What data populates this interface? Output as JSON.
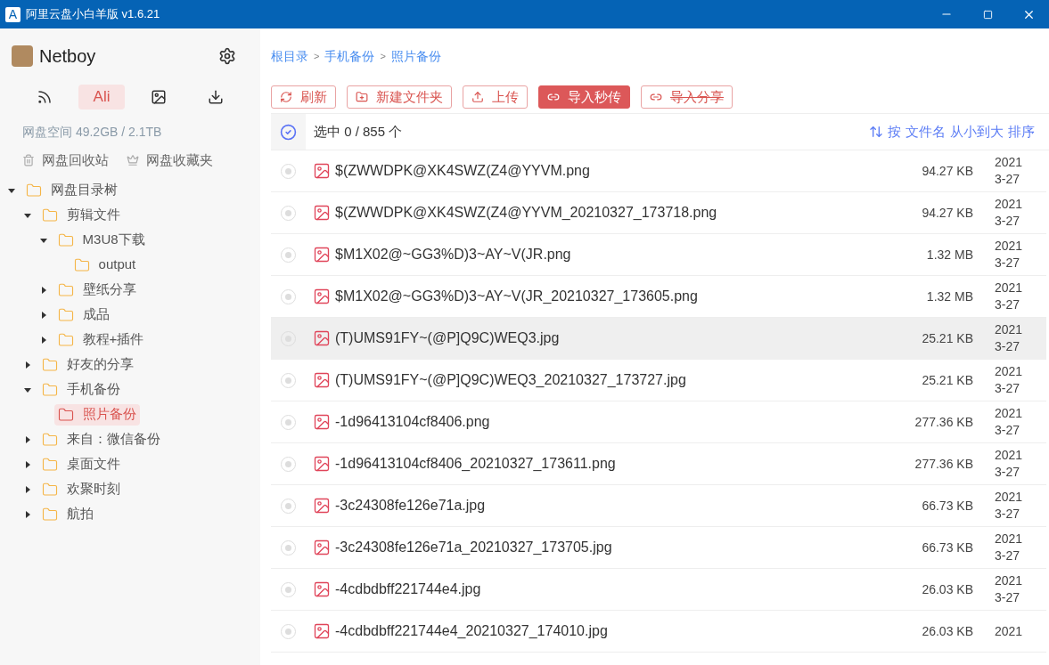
{
  "window": {
    "title": "阿里云盘小白羊版 v1.6.21",
    "logo": "A"
  },
  "user": {
    "name": "Netboy"
  },
  "tabs": [
    {
      "kind": "rss",
      "selected": false
    },
    {
      "kind": "text",
      "label": "Ali",
      "selected": true
    },
    {
      "kind": "image",
      "selected": false
    },
    {
      "kind": "download",
      "selected": false
    }
  ],
  "storage": "网盘空间 49.2GB / 2.1TB",
  "shortcuts": [
    {
      "kind": "trash",
      "label": "网盘回收站"
    },
    {
      "kind": "favorite",
      "label": "网盘收藏夹"
    }
  ],
  "tree": [
    {
      "label": "网盘目录树",
      "expanded": true,
      "selected": false,
      "children": [
        {
          "label": "剪辑文件",
          "expanded": true,
          "selected": false,
          "children": [
            {
              "label": "M3U8下载",
              "expanded": true,
              "selected": false,
              "children": [
                {
                  "label": "output",
                  "selected": false
                }
              ]
            },
            {
              "label": "壁纸分享",
              "expanded": false,
              "selected": false
            },
            {
              "label": "成品",
              "expanded": false,
              "selected": false
            },
            {
              "label": "教程+插件",
              "expanded": false,
              "selected": false
            }
          ]
        },
        {
          "label": "好友的分享",
          "expanded": false,
          "selected": false
        },
        {
          "label": "手机备份",
          "expanded": true,
          "selected": false,
          "children": [
            {
              "label": "照片备份",
              "selected": true
            }
          ]
        },
        {
          "label": "来自：微信备份",
          "expanded": false,
          "selected": false
        },
        {
          "label": "桌面文件",
          "expanded": false,
          "selected": false
        },
        {
          "label": "欢聚时刻",
          "expanded": false,
          "selected": false
        },
        {
          "label": "航拍",
          "expanded": false,
          "selected": false
        }
      ]
    }
  ],
  "breadcrumb": [
    "根目录",
    "手机备份",
    "照片备份"
  ],
  "breadcrumb_separator": ">",
  "toolbar": [
    {
      "kind": "refresh",
      "label": "刷新",
      "primary": false,
      "disabled": false
    },
    {
      "kind": "new-folder",
      "label": "新建文件夹",
      "primary": false,
      "disabled": false
    },
    {
      "kind": "upload",
      "label": "上传",
      "primary": false,
      "disabled": false
    },
    {
      "kind": "link",
      "label": "导入秒传",
      "primary": true,
      "disabled": false
    },
    {
      "kind": "link",
      "label": "导入分享",
      "primary": false,
      "disabled": true
    }
  ],
  "selection": {
    "all_checked": true,
    "text": "选中 0 / 855 个"
  },
  "sort": {
    "parts": [
      "按",
      "文件名",
      "从小到大",
      "排序"
    ]
  },
  "files": [
    {
      "name": "$(ZWWDPK@XK4SWZ(Z4@YYVM.png",
      "size": "94.27 KB",
      "date_1": "2021",
      "date_2": "3-27",
      "checked": false,
      "hovered": false
    },
    {
      "name": "$(ZWWDPK@XK4SWZ(Z4@YYVM_20210327_173718.png",
      "size": "94.27 KB",
      "date_1": "2021",
      "date_2": "3-27",
      "checked": false,
      "hovered": false
    },
    {
      "name": "$M1X02@~GG3%D)3~AY~V(JR.png",
      "size": "1.32 MB",
      "date_1": "2021",
      "date_2": "3-27",
      "checked": false,
      "hovered": false
    },
    {
      "name": "$M1X02@~GG3%D)3~AY~V(JR_20210327_173605.png",
      "size": "1.32 MB",
      "date_1": "2021",
      "date_2": "3-27",
      "checked": false,
      "hovered": false
    },
    {
      "name": "(T)UMS91FY~(@P]Q9C)WEQ3.jpg",
      "size": "25.21 KB",
      "date_1": "2021",
      "date_2": "3-27",
      "checked": false,
      "hovered": true
    },
    {
      "name": "(T)UMS91FY~(@P]Q9C)WEQ3_20210327_173727.jpg",
      "size": "25.21 KB",
      "date_1": "2021",
      "date_2": "3-27",
      "checked": false,
      "hovered": false
    },
    {
      "name": "-1d96413104cf8406.png",
      "size": "277.36 KB",
      "date_1": "2021",
      "date_2": "3-27",
      "checked": false,
      "hovered": false
    },
    {
      "name": "-1d96413104cf8406_20210327_173611.png",
      "size": "277.36 KB",
      "date_1": "2021",
      "date_2": "3-27",
      "checked": false,
      "hovered": false
    },
    {
      "name": "-3c24308fe126e71a.jpg",
      "size": "66.73 KB",
      "date_1": "2021",
      "date_2": "3-27",
      "checked": false,
      "hovered": false
    },
    {
      "name": "-3c24308fe126e71a_20210327_173705.jpg",
      "size": "66.73 KB",
      "date_1": "2021",
      "date_2": "3-27",
      "checked": false,
      "hovered": false
    },
    {
      "name": "-4cdbdbff221744e4.jpg",
      "size": "26.03 KB",
      "date_1": "2021",
      "date_2": "3-27",
      "checked": false,
      "hovered": false
    },
    {
      "name": "-4cdbdbff221744e4_20210327_174010.jpg",
      "size": "26.03 KB",
      "date_1": "2021",
      "checked": false,
      "hovered": false
    }
  ]
}
